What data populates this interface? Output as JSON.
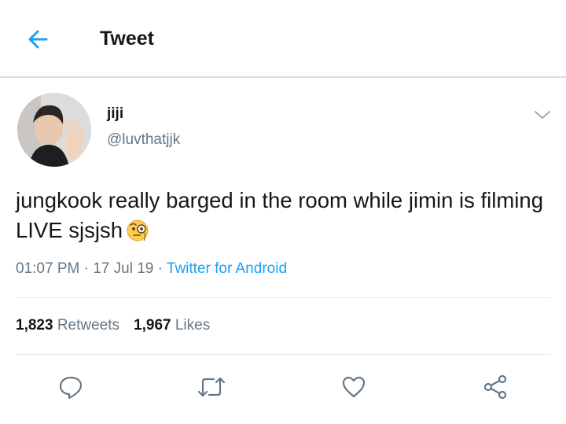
{
  "header": {
    "title": "Tweet",
    "back_icon": "arrow-left-icon"
  },
  "tweet": {
    "display_name": "jiji",
    "handle": "@luvthatjjk",
    "text": "jungkook really barged in the room while jimin is filming LIVE sjsjsh",
    "emoji": "face-with-monocle-emoji",
    "time": "01:07 PM",
    "date": "17 Jul 19",
    "separator": "·",
    "source": "Twitter for Android"
  },
  "stats": {
    "retweets_count": "1,823",
    "retweets_label": "Retweets",
    "likes_count": "1,967",
    "likes_label": "Likes"
  },
  "actions": [
    "reply-icon",
    "retweet-icon",
    "like-icon",
    "share-icon"
  ],
  "colors": {
    "accent": "#1da1f2",
    "secondary_text": "#657786",
    "primary_text": "#14171a"
  }
}
